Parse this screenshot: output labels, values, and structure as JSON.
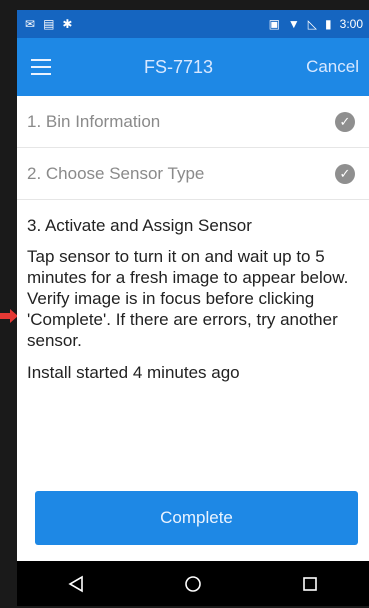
{
  "statusbar": {
    "time": "3:00",
    "left_icons": [
      "mail-icon",
      "notes-icon",
      "bug-icon"
    ],
    "right_icons": [
      "cast-icon",
      "wifi-icon",
      "no-signal-icon",
      "battery-icon"
    ]
  },
  "toolbar": {
    "title": "FS-7713",
    "cancel_label": "Cancel"
  },
  "steps": [
    {
      "label": "1. Bin Information",
      "status": "complete"
    },
    {
      "label": "2. Choose Sensor Type",
      "status": "complete"
    }
  ],
  "active_step": {
    "title": "3. Activate and Assign Sensor",
    "description": "Tap sensor to turn it on and wait up to 5 minutes for a fresh image to appear below. Verify image is in focus before clicking 'Complete'. If there are errors, try another sensor.",
    "status_text": "Install started 4 minutes ago"
  },
  "actions": {
    "complete_label": "Complete"
  },
  "colors": {
    "toolbar": "#1e88e5",
    "statusbar": "#1565c0",
    "button": "#1e88e5",
    "arrow": "#e53935"
  }
}
